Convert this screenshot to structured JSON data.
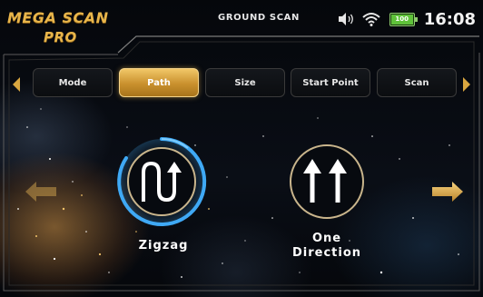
{
  "header": {
    "logo_line1": "MEGA SCAN",
    "logo_line2": "PRO",
    "title": "GROUND SCAN",
    "battery_label": "100",
    "battery_level": 1.0,
    "clock": "16:08"
  },
  "tabs": [
    {
      "label": "Mode",
      "active": false
    },
    {
      "label": "Path",
      "active": true
    },
    {
      "label": "Size",
      "active": false
    },
    {
      "label": "Start Point",
      "active": false
    },
    {
      "label": "Scan",
      "active": false
    }
  ],
  "options": [
    {
      "label": "Zigzag",
      "icon": "zigzag-path-icon",
      "selected": true
    },
    {
      "label_line1": "One",
      "label_line2": "Direction",
      "icon": "one-direction-icon",
      "selected": false
    }
  ],
  "colors": {
    "accent": "#e8b54a",
    "selection_ring": "#3fa9f5",
    "battery": "#5fc23a"
  },
  "icons": {
    "tab_prev": "triangle-left-icon",
    "tab_next": "triangle-right-icon",
    "page_prev": "arrow-left-icon",
    "page_next": "arrow-right-icon",
    "volume": "speaker-icon",
    "wifi": "wifi-icon",
    "battery": "battery-icon"
  }
}
